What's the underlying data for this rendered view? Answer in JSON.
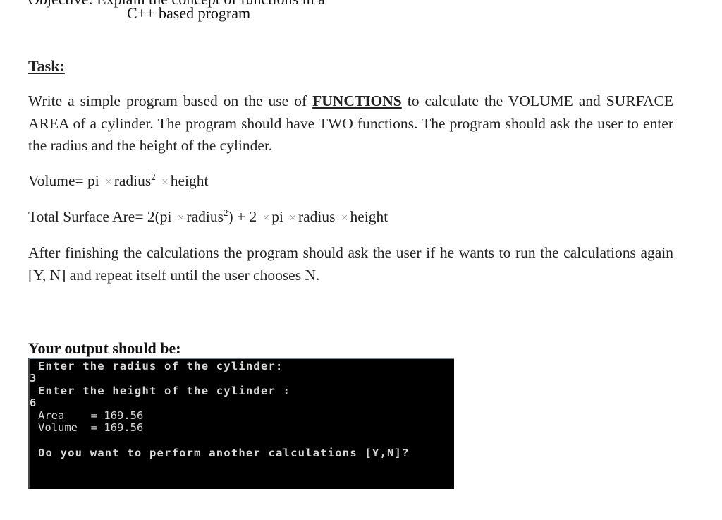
{
  "document": {
    "cut_off_top_line": "Objective: Explain the concept of functions in a",
    "subtitle": "C++ based program",
    "task_heading": "Task:",
    "task_paragraph": {
      "before_keyword": "Write  a simple program based  on  the  use  of ",
      "keyword": "FUNCTIONS",
      "after_keyword": " to calculate the VOLUME and SURFACE AREA of a cylinder. The program should have TWO functions. The program should ask the user to enter the radius and the height of the cylinder."
    },
    "formulas": {
      "volume": {
        "label": "Volume= pi",
        "times_symbol": "×",
        "term2": "radius",
        "exponent": "2",
        "term3": "height"
      },
      "surface_area": {
        "label": "Total Surface Are= 2(pi",
        "times_symbol": "×",
        "term2": "radius",
        "exponent": "2",
        "term2_close": ") + 2",
        "term3": "pi",
        "term4": "radius",
        "term5": "height"
      }
    },
    "repeat_paragraph": "After finishing the calculations the program should ask the user if he wants to run the calculations again [Y, N] and repeat itself until the user chooses N.",
    "output_heading": "Your output should be:"
  },
  "console": {
    "lines": [
      "Enter the radius of the cylinder:",
      "3",
      "Enter the height of the cylinder :",
      "6",
      "Area    = 169.56",
      "Volume  = 169.56",
      "Do you want to perform another calculations [Y,N]?"
    ],
    "background_color": "#000000",
    "text_color": "#d8d8d8"
  }
}
